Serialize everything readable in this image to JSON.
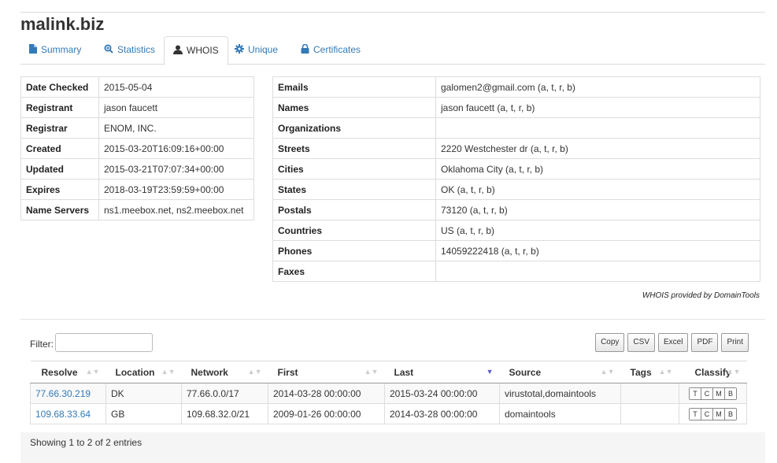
{
  "domain": "malink.biz",
  "tabs": [
    {
      "label": "Summary",
      "icon": "file-icon"
    },
    {
      "label": "Statistics",
      "icon": "search-icon"
    },
    {
      "label": "WHOIS",
      "icon": "user-icon"
    },
    {
      "label": "Unique",
      "icon": "cog-icon"
    },
    {
      "label": "Certificates",
      "icon": "lock-icon"
    }
  ],
  "whois_left": [
    {
      "key": "Date Checked",
      "value": "2015-05-04"
    },
    {
      "key": "Registrant",
      "value": "jason faucett"
    },
    {
      "key": "Registrar",
      "value": "ENOM, INC."
    },
    {
      "key": "Created",
      "value": "2015-03-20T16:09:16+00:00"
    },
    {
      "key": "Updated",
      "value": "2015-03-21T07:07:34+00:00"
    },
    {
      "key": "Expires",
      "value": "2018-03-19T23:59:59+00:00"
    },
    {
      "key": "Name Servers",
      "value": "ns1.meebox.net, ns2.meebox.net"
    }
  ],
  "whois_right": [
    {
      "key": "Emails",
      "value": "galomen2@gmail.com (a, t, r, b)"
    },
    {
      "key": "Names",
      "value": "jason faucett (a, t, r, b)"
    },
    {
      "key": "Organizations",
      "value": ""
    },
    {
      "key": "Streets",
      "value": "2220 Westchester dr (a, t, r, b)"
    },
    {
      "key": "Cities",
      "value": "Oklahoma City (a, t, r, b)"
    },
    {
      "key": "States",
      "value": "OK (a, t, r, b)"
    },
    {
      "key": "Postals",
      "value": "73120 (a, t, r, b)"
    },
    {
      "key": "Countries",
      "value": "US (a, t, r, b)"
    },
    {
      "key": "Phones",
      "value": "14059222418 (a, t, r, b)"
    },
    {
      "key": "Faxes",
      "value": ""
    }
  ],
  "provided_by": "WHOIS provided by DomainTools",
  "filter": {
    "label": "Filter:",
    "value": ""
  },
  "export_buttons": [
    "Copy",
    "CSV",
    "Excel",
    "PDF",
    "Print"
  ],
  "resolutions": {
    "columns": [
      "Resolve",
      "Location",
      "Network",
      "First",
      "Last",
      "Source",
      "Tags",
      "Classify"
    ],
    "sorted_column": "Last",
    "rows": [
      {
        "resolve": "77.66.30.219",
        "location": "DK",
        "network": "77.66.0.0/17",
        "first": "2014-03-28 00:00:00",
        "last": "2015-03-24 00:00:00",
        "source": "virustotal,domaintools",
        "tags": ""
      },
      {
        "resolve": "109.68.33.64",
        "location": "GB",
        "network": "109.68.32.0/21",
        "first": "2009-01-26 00:00:00",
        "last": "2014-03-28 00:00:00",
        "source": "domaintools",
        "tags": ""
      }
    ],
    "classify_buttons": [
      "T",
      "C",
      "M",
      "B"
    ],
    "info": "Showing 1 to 2 of 2 entries"
  }
}
